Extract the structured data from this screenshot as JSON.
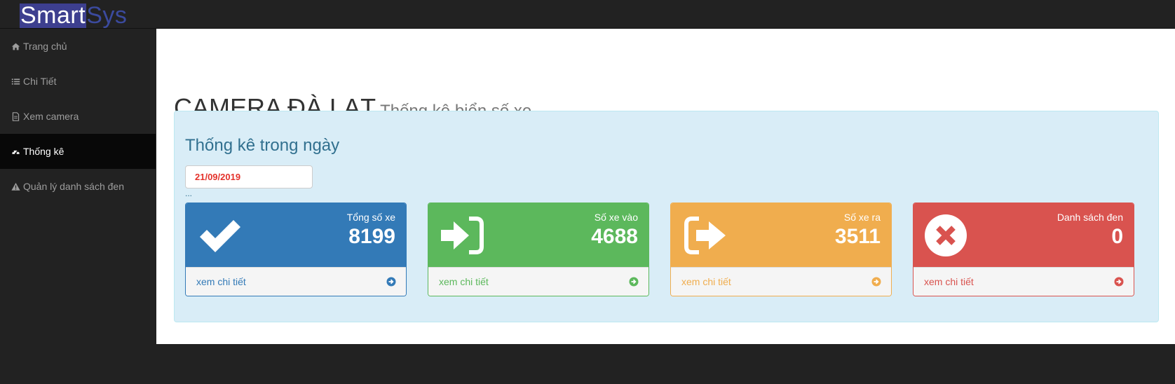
{
  "brand": {
    "part1": "Smart",
    "part2": "Sys"
  },
  "sidebar": {
    "items": [
      {
        "label": "Trang chủ",
        "icon": "home-icon"
      },
      {
        "label": "Chi Tiết",
        "icon": "list-icon"
      },
      {
        "label": "Xem camera",
        "icon": "file-icon"
      },
      {
        "label": "Thống kê",
        "icon": "dashboard-icon",
        "active": true
      },
      {
        "label": "Quản lý danh sách đen",
        "icon": "warning-icon"
      }
    ]
  },
  "header": {
    "title": "CAMERA ĐÀ LẠT",
    "subtitle": "Thống kê biển số xe"
  },
  "panel": {
    "title": "Thống kê trong ngày",
    "date_value": "21/09/2019",
    "ellipsis": "..."
  },
  "stats": [
    {
      "label": "Tổng số xe",
      "value": "8199",
      "link": "xem chi tiết",
      "color": "#337ab7",
      "icon": "check-icon"
    },
    {
      "label": "Số xe vào",
      "value": "4688",
      "link": "xem chi tiết",
      "color": "#5cb85c",
      "icon": "sign-in-icon"
    },
    {
      "label": "Số xe ra",
      "value": "3511",
      "link": "xem chi tiết",
      "color": "#f0ad4e",
      "icon": "sign-out-icon"
    },
    {
      "label": "Danh sách đen",
      "value": "0",
      "link": "xem chi tiết",
      "color": "#d9534f",
      "icon": "times-circle-icon"
    }
  ]
}
